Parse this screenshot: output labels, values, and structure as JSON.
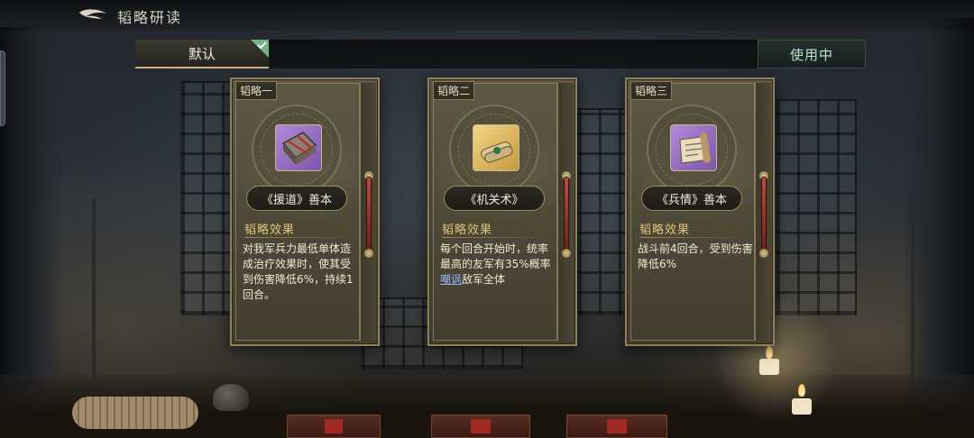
{
  "header": {
    "title": "韬略研读"
  },
  "topbar": {
    "default_tab_label": "默认",
    "in_use_label": "使用中"
  },
  "cards": [
    {
      "slot_label": "韬略一",
      "name": "《援道》善本",
      "icon": "purple-bound-book-icon",
      "effect_title": "韬略效果",
      "effect_text": "对我军兵力最低单体造成治疗效果时，使其受到伤害降低6%，持续1回合。"
    },
    {
      "slot_label": "韬略二",
      "name": "《机关术》",
      "icon": "gold-scroll-bundle-icon",
      "effect_title": "韬略效果",
      "effect_text_before": "每个回合开始时，统率最高的友军有35%概率",
      "effect_text_highlight": "嘲讽",
      "effect_text_after": "敌军全体"
    },
    {
      "slot_label": "韬略三",
      "name": "《兵情》善本",
      "icon": "purple-scroll-icon",
      "effect_title": "韬略效果",
      "effect_text": "战斗前4回合，受到伤害降低6%"
    }
  ],
  "colors": {
    "accent_gold": "#e3c47a",
    "in_use_green": "#b9e3c7",
    "highlight_blue": "#8fb6ff"
  }
}
